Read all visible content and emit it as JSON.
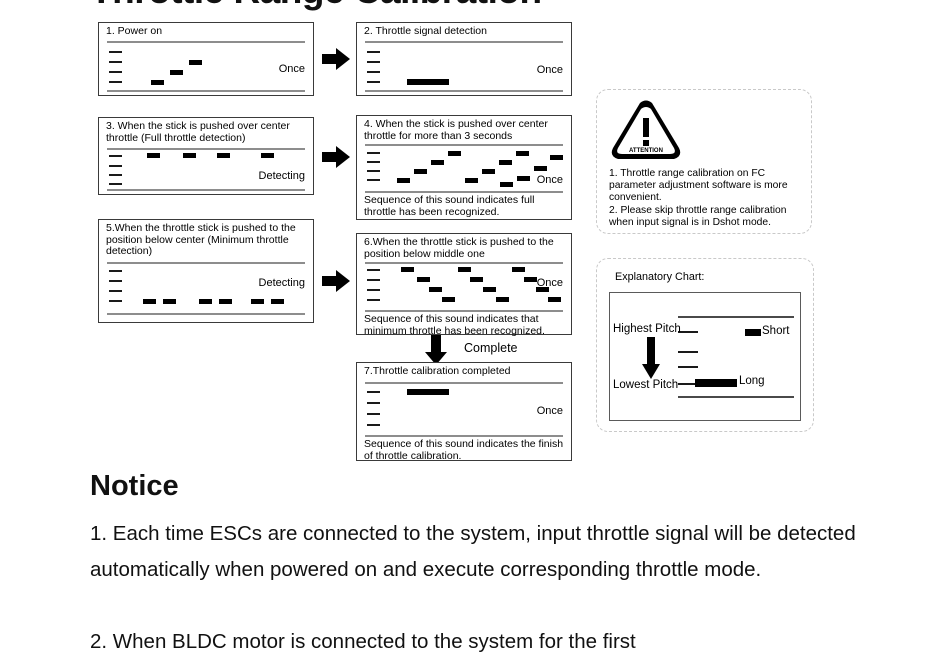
{
  "page": {
    "title": "Throttle Range Calibration",
    "notice_heading": "Notice"
  },
  "steps": [
    {
      "id": "step-1",
      "title": "1. Power on",
      "repeat_label": "Once",
      "caption": "",
      "tone_pattern": "ascending-3-notes"
    },
    {
      "id": "step-2",
      "title": "2. Throttle signal detection",
      "repeat_label": "Once",
      "caption": "",
      "tone_pattern": "single-long-low-note"
    },
    {
      "id": "step-3",
      "title": "3. When the stick is pushed over center throttle  (Full throttle detection)",
      "repeat_label": "Detecting",
      "caption": "",
      "tone_pattern": "four-high-short-notes"
    },
    {
      "id": "step-4",
      "title": "4. When the stick is pushed over center throttle for more than 3 seconds",
      "repeat_label": "Once",
      "caption": "Sequence of this sound indicates full throttle has been recognized.",
      "tone_pattern": "three-ascending-runs"
    },
    {
      "id": "step-5",
      "title": "5.When the throttle stick is pushed to the position below center (Minimum throttle detection)",
      "repeat_label": "Detecting",
      "caption": "",
      "tone_pattern": "six-low-short-notes"
    },
    {
      "id": "step-6",
      "title": "6.When the throttle stick is pushed to the position below middle one",
      "repeat_label": "Once",
      "caption": "Sequence of this sound indicates that minimum throttle has been recognized.",
      "tone_pattern": "three-descending-runs"
    },
    {
      "id": "step-7",
      "title": "7.Throttle calibration completed",
      "repeat_label": "Once",
      "caption": "Sequence of this sound indicates the finish of throttle calibration.",
      "tone_pattern": "single-long-high-note"
    }
  ],
  "flow": {
    "complete_label": "Complete"
  },
  "attention": {
    "icon_caption": "ATTENTION",
    "line1": "1. Throttle range calibration on FC parameter adjustment software is more convenient.",
    "line2": "2. Please skip throttle range calibration when input signal is in Dshot mode."
  },
  "explanatory_chart": {
    "title": "Explanatory Chart:",
    "highest_label": "Highest Pitch",
    "lowest_label": "Lowest Pitch",
    "short_label": "Short",
    "long_label": "Long"
  },
  "notice": {
    "item1": "1. Each time ESCs are connected to the system, input throttle signal will be detected automatically when powered on and execute corresponding throttle mode.",
    "item2": "2. When BLDC motor is connected to the system for the first"
  },
  "colors": {
    "ink": "#000000",
    "rule": "#8d8d8d",
    "box_border": "#3a3a3a",
    "panel_border": "#c9c9c9"
  }
}
